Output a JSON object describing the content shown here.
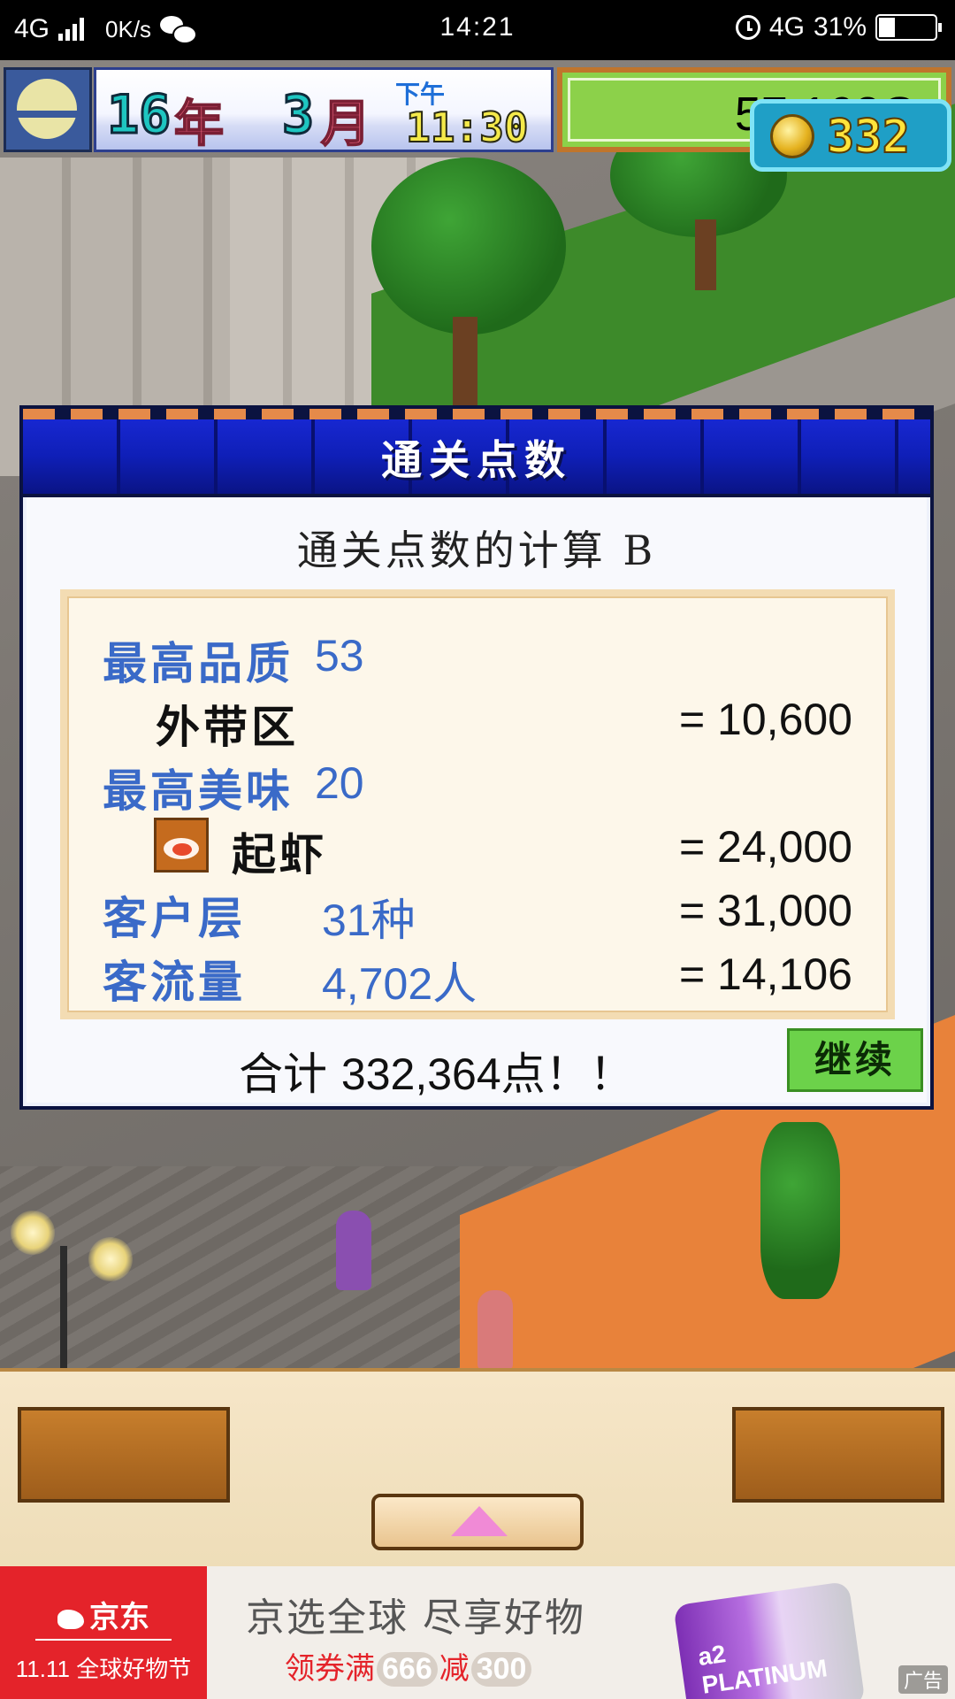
{
  "status_bar": {
    "network_left": "4G",
    "speed": "0K/s",
    "time": "14:21",
    "network_right": "4G",
    "battery": "31%",
    "battery_level": 0.31,
    "icons": [
      "signal-icon",
      "wechat-icon",
      "alarm-icon",
      "battery-icon"
    ]
  },
  "hud": {
    "year": "16",
    "year_unit": "年",
    "month": "3",
    "month_unit": "月",
    "ampm": "下午",
    "clock": "11:30",
    "gold": "57,162G",
    "coins": "332"
  },
  "dialog": {
    "title": "通关点数",
    "subtitle": "通关点数的计算 B",
    "rows": [
      {
        "label": "最高品质",
        "value": "53"
      },
      {
        "label": "外带区",
        "value": "= 10,600"
      },
      {
        "label": "最高美味",
        "value": "20"
      },
      {
        "label": "起虾",
        "value": "= 24,000"
      },
      {
        "label": "客户层",
        "value": "31种",
        "result": "= 31,000"
      },
      {
        "label": "客流量",
        "value": "4,702人",
        "result": "= 14,106"
      }
    ],
    "total_prefix": "合计",
    "total_value": "332,364",
    "total_suffix": "点！！",
    "continue_label": "继续"
  },
  "ad": {
    "brand": "京东",
    "festival": "全球好物节",
    "festival_mark": "11.11",
    "headline": "京选全球 尽享好物",
    "promo_pre": "领券满",
    "promo_a": "666",
    "promo_mid": "减",
    "promo_b": "300",
    "product": "a2 PLATINUM",
    "tag": "广告",
    "accent": "#e4232a"
  }
}
